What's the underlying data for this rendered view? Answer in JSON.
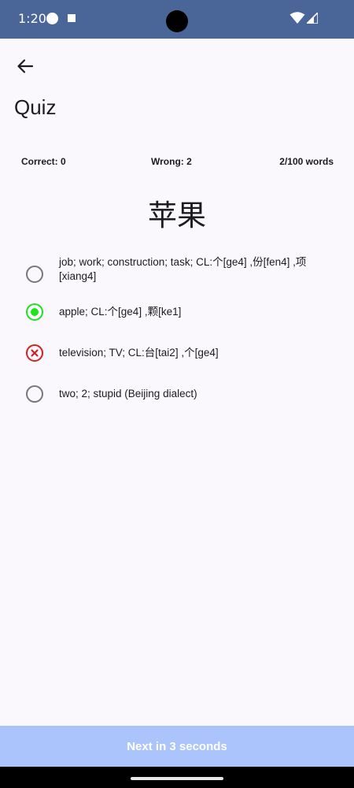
{
  "status_bar": {
    "time": "1:20",
    "background_color": "#4a6699",
    "icons": [
      "notification-dot-icon",
      "notification-square-icon",
      "wifi-icon",
      "cellular-signal-icon"
    ]
  },
  "header": {
    "back_icon": "arrow-left-icon",
    "title": "Quiz"
  },
  "stats": {
    "correct": "Correct: 0",
    "wrong": "Wrong: 2",
    "progress": "2/100 words"
  },
  "quiz": {
    "word": "苹果",
    "options": [
      {
        "label": "job; work; construction; task; CL:个[ge4] ,份[fen4] ,项[xiang4]",
        "state": "unselected"
      },
      {
        "label": "apple; CL:个[ge4] ,颗[ke1]",
        "state": "correct"
      },
      {
        "label": "television; TV; CL:台[tai2] ,个[ge4]",
        "state": "wrong"
      },
      {
        "label": "two; 2; stupid (Beijing dialect)",
        "state": "unselected"
      }
    ]
  },
  "footer": {
    "next_label": "Next in 3 seconds",
    "background_color": "#abc4fb"
  },
  "colors": {
    "correct": "#1ee31e",
    "wrong": "#d32020",
    "unselected": "#79767d"
  }
}
